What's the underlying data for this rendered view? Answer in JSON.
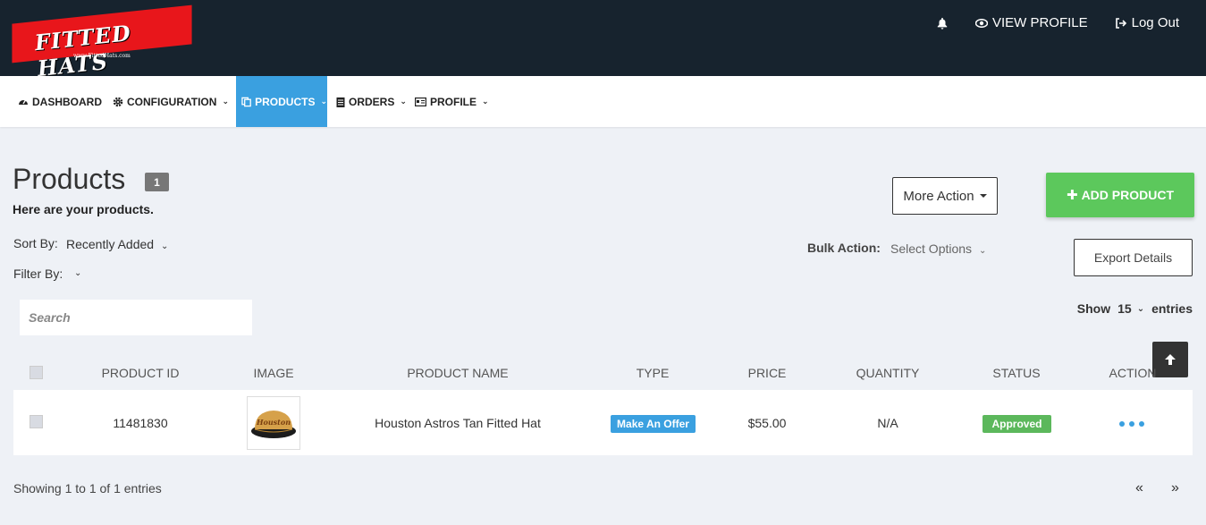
{
  "brand": {
    "logo_text": "FITTED HATS",
    "logo_url": "www.FittedHats.com"
  },
  "topbar": {
    "notification_icon": "bell-icon",
    "view_profile": "VIEW PROFILE",
    "logout": "Log Out"
  },
  "nav": {
    "items": [
      {
        "label": "DASHBOARD",
        "icon": "dashboard-icon",
        "dropdown": false
      },
      {
        "label": "CONFIGURATION",
        "icon": "gear-icon",
        "dropdown": true
      },
      {
        "label": "PRODUCTS",
        "icon": "copy-icon",
        "dropdown": true,
        "active": true
      },
      {
        "label": "ORDERS",
        "icon": "clipboard-icon",
        "dropdown": true
      },
      {
        "label": "PROFILE",
        "icon": "id-card-icon",
        "dropdown": true
      }
    ]
  },
  "page": {
    "title": "Products",
    "count": "1",
    "subtitle": "Here are your products.",
    "sort_label": "Sort By:",
    "sort_value": "Recently Added",
    "filter_label": "Filter By:",
    "more_action": "More Action",
    "add_product": "ADD PRODUCT",
    "bulk_label": "Bulk Action:",
    "bulk_value": "Select Options",
    "export": "Export Details",
    "search_placeholder": "Search",
    "show_label": "Show",
    "show_value": "15",
    "entries_label": "entries"
  },
  "table": {
    "columns": [
      "PRODUCT ID",
      "IMAGE",
      "PRODUCT NAME",
      "TYPE",
      "PRICE",
      "QUANTITY",
      "STATUS",
      "ACTION"
    ],
    "rows": [
      {
        "product_id": "11481830",
        "image": "Houston Astros tan fitted hat",
        "product_name": "Houston Astros Tan Fitted Hat",
        "type": "Make An Offer",
        "price": "$55.00",
        "quantity": "N/A",
        "status": "Approved"
      }
    ]
  },
  "footer": {
    "info": "Showing 1 to 1 of 1 entries",
    "prev": "«",
    "next": "»"
  },
  "colors": {
    "topbar": "#17232e",
    "accent_blue": "#3aa0e0",
    "add_green": "#5cc85c",
    "status_green": "#5cb85c",
    "logo_red": "#e8161b"
  }
}
